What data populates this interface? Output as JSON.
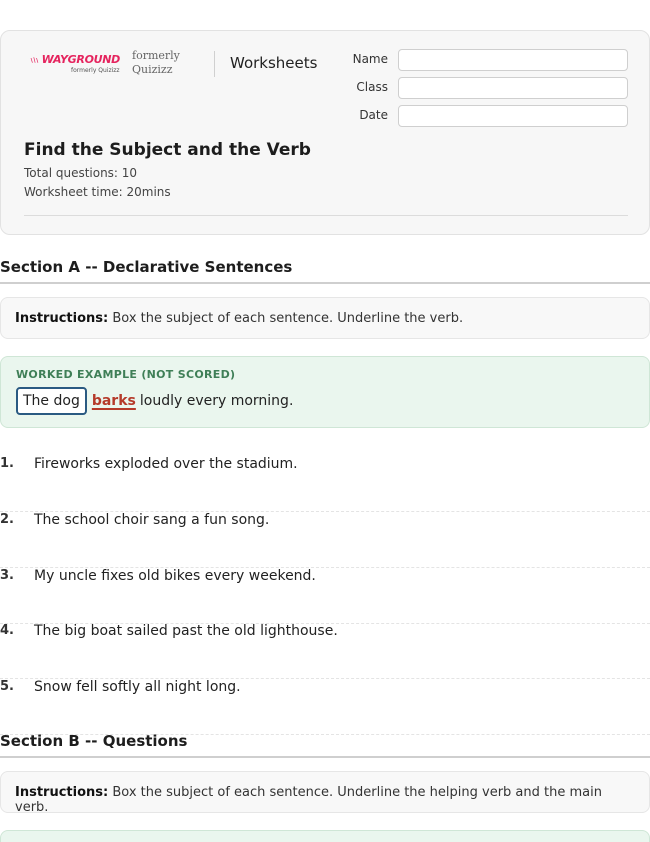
{
  "header": {
    "logo_text": "WAYGROUND",
    "logo_sub": "formerly Quizizz",
    "formerly_line1": "formerly",
    "formerly_line2": "Quizizz",
    "worksheets_label": "Worksheets",
    "fields": [
      {
        "label": "Name",
        "value": ""
      },
      {
        "label": "Class",
        "value": ""
      },
      {
        "label": "Date",
        "value": ""
      }
    ],
    "title": "Find the Subject and the Verb",
    "total_questions": "Total questions: 10",
    "worksheet_time": "Worksheet time: 20mins"
  },
  "section_a": {
    "title": "Section A -- Declarative Sentences",
    "instructions_label": "Instructions:",
    "instructions_text": " Box the subject of each sentence. Underline the verb.",
    "example": {
      "label": "WORKED EXAMPLE (NOT SCORED)",
      "subject": "The dog",
      "verb": "barks",
      "rest": "loudly every morning."
    },
    "questions": [
      {
        "num": "1.",
        "text": "Fireworks exploded over the stadium."
      },
      {
        "num": "2.",
        "text": "The school choir sang a fun song."
      },
      {
        "num": "3.",
        "text": "My uncle fixes old bikes every weekend."
      },
      {
        "num": "4.",
        "text": "The big boat sailed past the old lighthouse."
      },
      {
        "num": "5.",
        "text": "Snow fell softly all night long."
      }
    ]
  },
  "section_b": {
    "title": "Section B -- Questions",
    "instructions_label": "Instructions:",
    "instructions_text": " Box the subject of each sentence. Underline the helping verb and the main verb."
  },
  "colors": {
    "brand": "#e5245e",
    "example_bg": "#eaf6ee",
    "example_label": "#3f7f57",
    "subject_box": "#2a5a82",
    "verb": "#b53a2a"
  }
}
